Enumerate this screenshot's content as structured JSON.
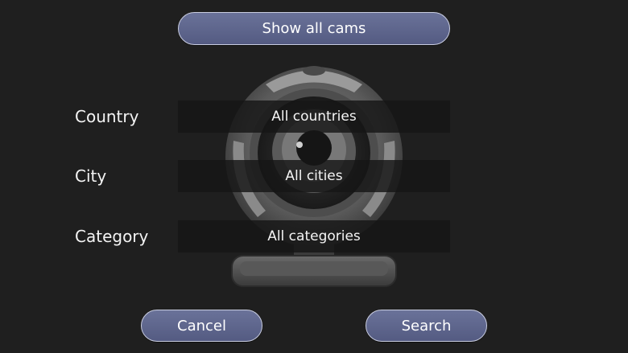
{
  "buttons": {
    "show_all": "Show all cams",
    "cancel": "Cancel",
    "search": "Search"
  },
  "filters": [
    {
      "label": "Country",
      "value": "All countries"
    },
    {
      "label": "City",
      "value": "All cities"
    },
    {
      "label": "Category",
      "value": "All categories"
    }
  ],
  "colors": {
    "background": "#1f1f1f",
    "button_fill": "#5a6289",
    "button_border": "#c9cde0",
    "field_fill": "#161616",
    "text": "#f4f4f4"
  },
  "icons": {
    "background_art": "webcam-illustration"
  }
}
